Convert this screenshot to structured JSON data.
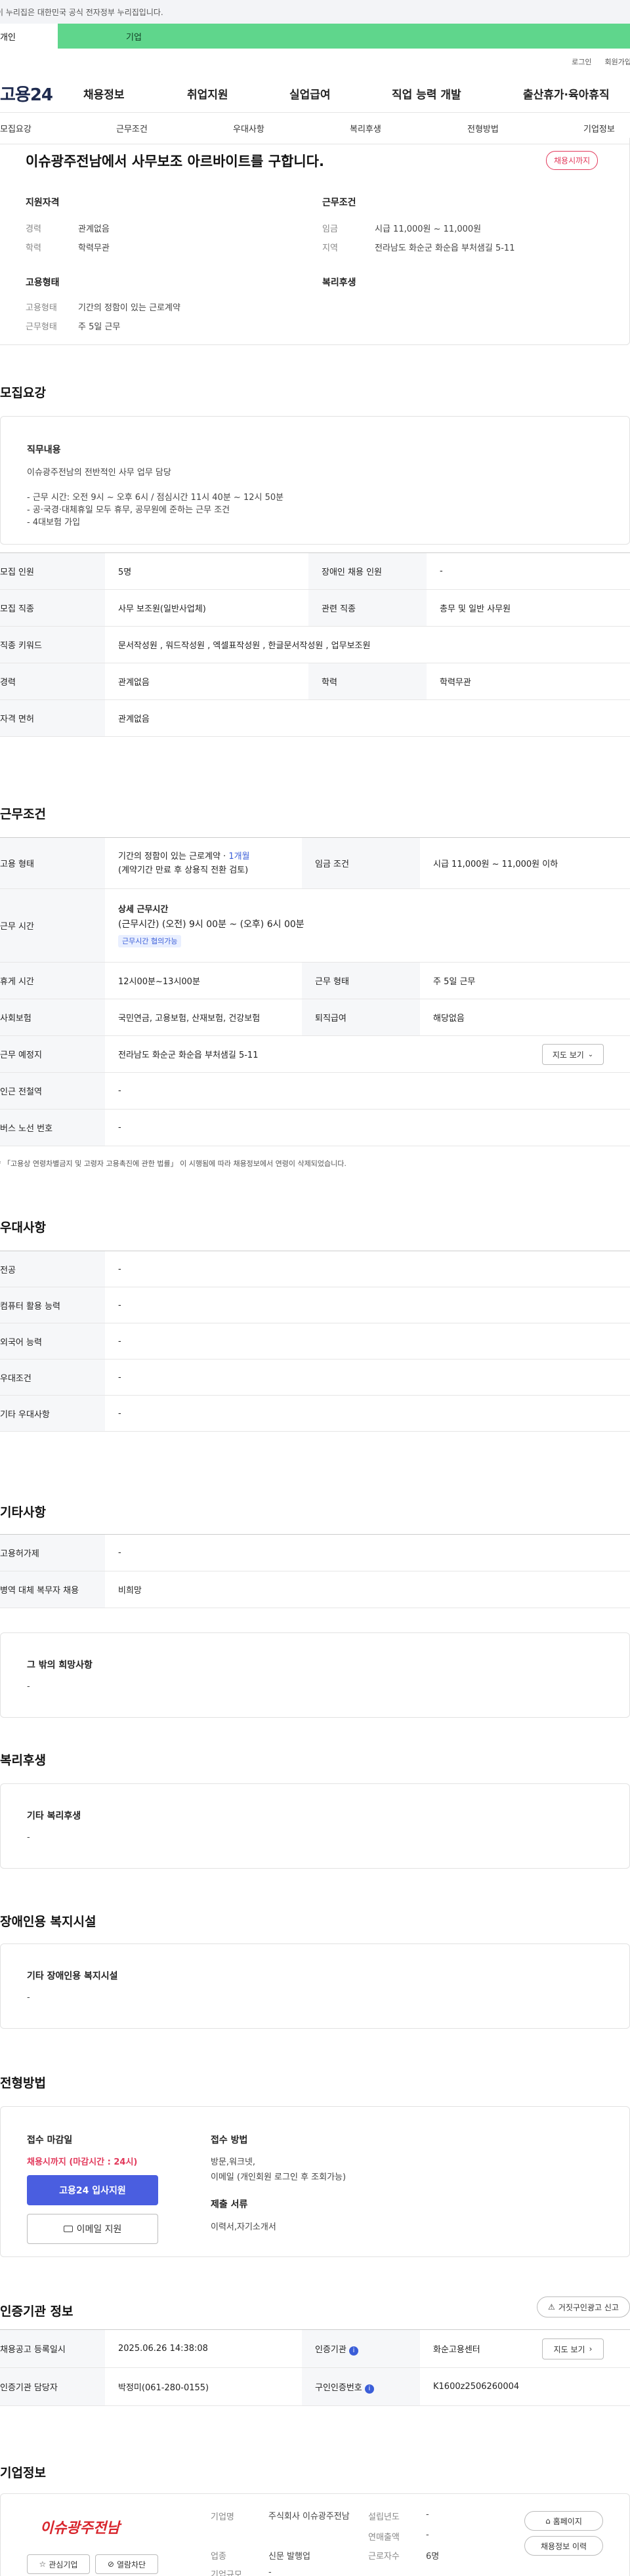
{
  "gov_notice": "이 누리집은 대한민국 공식 전자정부 누리집입니다.",
  "member_tabs": {
    "person": "개인",
    "biz": "기업"
  },
  "top_links": {
    "login": "로그인",
    "signup": "회원가입"
  },
  "logo": "고용24",
  "gnb": [
    "채용정보",
    "취업지원",
    "실업급여",
    "직업 능력 개발",
    "출산휴가·육아휴직"
  ],
  "subnav": [
    "모집요강",
    "근무조건",
    "우대사항",
    "복리후생",
    "전형방법",
    "기업정보"
  ],
  "summary": {
    "title": "이슈광주전남에서 사무보조 아르바이트를 구합니다.",
    "badge": "채용시까지",
    "qual_title": "지원자격",
    "qual": [
      {
        "label": "경력",
        "value": "관계없음"
      },
      {
        "label": "학력",
        "value": "학력무관"
      }
    ],
    "cond_title": "근무조건",
    "cond": [
      {
        "label": "임금",
        "value": "시급 11,000원 ~ 11,000원"
      },
      {
        "label": "지역",
        "value": "전라남도 화순군 화순읍 부처샘길 5-11"
      }
    ],
    "emp_title": "고용형태",
    "emp": [
      {
        "label": "고용형태",
        "value": "기간의 정함이 있는 근로계약"
      },
      {
        "label": "근무형태",
        "value": "주 5일 근무"
      }
    ],
    "welfare_title": "복리후생"
  },
  "recruit": {
    "section_title": "모집요강",
    "duty_title": "직무내용",
    "duty_lines": [
      "이슈광주전남의 전반적인 사무 업무 담당",
      "",
      "- 근무 시간: 오전 9시 ~ 오후 6시 / 점심시간 11시 40분 ~ 12시 50분",
      "- 공·국경·대체휴일 모두 휴무, 공무원에 준하는 근무 조건",
      "- 4대보험 가입"
    ],
    "rows": [
      {
        "l1": "모집 인원",
        "v1": "5명",
        "l2": "장애인 채용 인원",
        "v2": "-"
      },
      {
        "l1": "모집 직종",
        "v1": "사무 보조원(일반사업체)",
        "l2": "관련 직종",
        "v2": "총무 및 일반 사무원"
      },
      {
        "l1": "직종 키워드",
        "v1": "문서작성원 , 워드작성원 , 엑셀표작성원 , 한글문서작성원 , 업무보조원",
        "l2": "",
        "v2": ""
      },
      {
        "l1": "경력",
        "v1": "관계없음",
        "l2": "학력",
        "v2": "학력무관"
      },
      {
        "l1": "자격 면허",
        "v1": "관계없음",
        "l2": "",
        "v2": ""
      }
    ]
  },
  "work": {
    "section_title": "근무조건",
    "emp_label": "고용 형태",
    "emp_value": "기간의 정함이 있는 근로계약 · ",
    "emp_months": "1개월",
    "emp_note": "(계약기간 만료 후 상용직 전환 검토)",
    "wage_label": "임금 조건",
    "wage_value": "시급 11,000원 ~ 11,000원 이하",
    "hours_label": "근무 시간",
    "hours_title": "상세 근무시간",
    "hours_value": "(근무시간) (오전) 9시 00분 ~ (오후) 6시 00분",
    "hours_pill": "근무시간 협의가능",
    "rest_label": "휴게 시간",
    "rest_value": "12시00분~13시00분",
    "shift_label": "근무 형태",
    "shift_value": "주 5일 근무",
    "ins_label": "사회보험",
    "ins_value": "국민연금, 고용보험, 산재보험, 건강보험",
    "ret_label": "퇴직급여",
    "ret_value": "해당없음",
    "place_label": "근무 예정지",
    "place_value": "전라남도 화순군 화순읍 부처샘길 5-11",
    "map_btn": "지도 보기",
    "subway_label": "인근 전철역",
    "subway_value": "-",
    "bus_label": "버스 노선 번호",
    "bus_value": "-",
    "footnote": "「고용상 연령차별금지 및 고령자 고용촉진에 관한 법률」 이 시행됨에 따라 채용정보에서 연령이 삭제되었습니다."
  },
  "pref": {
    "section_title": "우대사항",
    "rows": [
      {
        "label": "전공",
        "value": "-"
      },
      {
        "label": "컴퓨터 활용 능력",
        "value": "-"
      },
      {
        "label": "외국어 능력",
        "value": "-"
      },
      {
        "label": "우대조건",
        "value": "-"
      },
      {
        "label": "기타 우대사항",
        "value": "-"
      }
    ]
  },
  "etc": {
    "section_title": "기타사항",
    "rows": [
      {
        "label": "고용허가제",
        "value": "-"
      },
      {
        "label": "병역 대체 복무자 채용",
        "value": "비희망"
      }
    ],
    "hope_title": "그 밖의 희망사항",
    "hope_value": "-"
  },
  "welfare": {
    "section_title": "복리후생",
    "box_title": "기타 복리후생",
    "box_value": "-"
  },
  "disabled": {
    "section_title": "장애인용 복지시설",
    "box_title": "기타 장애인용 복지시설",
    "box_value": "-"
  },
  "process": {
    "section_title": "전형방법",
    "deadline_title": "접수 마감일",
    "deadline_value": "채용시까지 (마감시간 : 24시)",
    "apply_btn": "고용24 입사지원",
    "email_btn": "이메일 지원",
    "method_title": "접수 방법",
    "method_lines": [
      "방문,워크넷,",
      "이메일 (개인회원 로그인 후 조회가능)"
    ],
    "docs_title": "제출 서류",
    "docs_value": "이력서,자기소개서"
  },
  "cert": {
    "section_title": "인증기관 정보",
    "report_btn": "거짓구인광고 신고",
    "r1l1": "채용공고 등록일시",
    "r1v1": "2025.06.26 14:38:08",
    "r1l2": "인증기관",
    "r1v2": "화순고용센터",
    "map_btn": "지도 보기",
    "r2l1": "인증기관 담당자",
    "r2v1": "박정미(061-280-0155)",
    "r2l2": "구인인증번호",
    "r2v2": "K1600z2506260004"
  },
  "company": {
    "section_title": "기업정보",
    "logo_text": "이슈광주전남",
    "fav_btn": "관심기업",
    "block_btn": "열람차단",
    "name_label": "기업명",
    "name_value": "주식회사 이슈광주전남",
    "industry_label": "업종",
    "industry_value": "신문 발행업",
    "size_label": "기업규모",
    "size_value": "-",
    "founded_label": "설립년도",
    "founded_value": "-",
    "sales_label": "연매출액",
    "sales_value": "-",
    "staff_label": "근로자수",
    "staff_value": "6명",
    "home_btn": "홈페이지",
    "history_btn": "채용정보 이력"
  }
}
